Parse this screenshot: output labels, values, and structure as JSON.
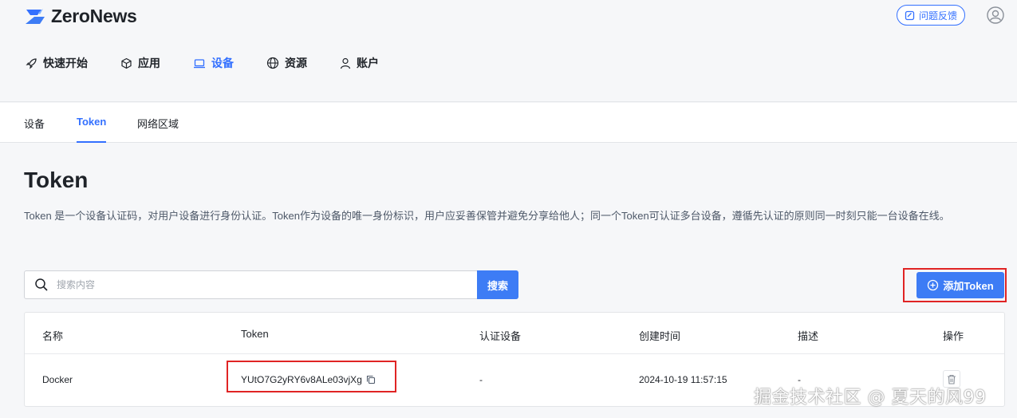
{
  "app": {
    "name": "ZeroNews",
    "feedback_label": "问题反馈"
  },
  "nav": [
    {
      "label": "快速开始",
      "icon": "rocket-icon",
      "active": false
    },
    {
      "label": "应用",
      "icon": "cube-icon",
      "active": false
    },
    {
      "label": "设备",
      "icon": "laptop-icon",
      "active": true
    },
    {
      "label": "资源",
      "icon": "globe-icon",
      "active": false
    },
    {
      "label": "账户",
      "icon": "user-icon",
      "active": false
    }
  ],
  "subtabs": [
    {
      "label": "设备",
      "active": false
    },
    {
      "label": "Token",
      "active": true
    },
    {
      "label": "网络区域",
      "active": false
    }
  ],
  "page": {
    "title": "Token",
    "description": "Token 是一个设备认证码，对用户设备进行身份认证。Token作为设备的唯一身份标识，用户应妥善保管并避免分享给他人；同一个Token可认证多台设备，遵循先认证的原则同一时刻只能一台设备在线。"
  },
  "search": {
    "placeholder": "搜索内容",
    "value": "",
    "button_label": "搜索"
  },
  "add_button": {
    "label": "添加Token"
  },
  "table": {
    "columns": [
      "名称",
      "Token",
      "认证设备",
      "创建时间",
      "描述",
      "操作"
    ],
    "rows": [
      {
        "name": "Docker",
        "token": "YUtO7G2yRY6v8ALe03vjXg",
        "device": "-",
        "created": "2024-10-19 11:57:15",
        "desc": "-"
      }
    ]
  },
  "watermark": "掘金技术社区 @ 夏天的风99",
  "colors": {
    "accent": "#3370ff",
    "button": "#3d7cf5",
    "highlight": "#e02424"
  }
}
